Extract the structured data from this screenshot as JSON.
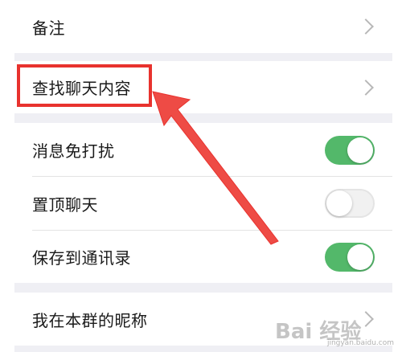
{
  "settings": {
    "rows": [
      {
        "label": "备注",
        "control": "chevron"
      },
      {
        "label": "查找聊天内容",
        "control": "chevron"
      },
      {
        "label": "消息免打扰",
        "control": "toggle",
        "state": "on"
      },
      {
        "label": "置顶聊天",
        "control": "toggle",
        "state": "off"
      },
      {
        "label": "保存到通讯录",
        "control": "toggle",
        "state": "on"
      },
      {
        "label": "我在本群的昵称",
        "control": "chevron"
      }
    ]
  },
  "annotation": {
    "highlight_color": "#e8322e",
    "target": "查找聊天内容"
  },
  "colors": {
    "toggle_on": "#53b86a",
    "toggle_off": "#f1f1f1",
    "section_gap": "#efeff4"
  },
  "watermark": {
    "main": "Bai 经验",
    "sub": "jingyan.baidu.com"
  }
}
